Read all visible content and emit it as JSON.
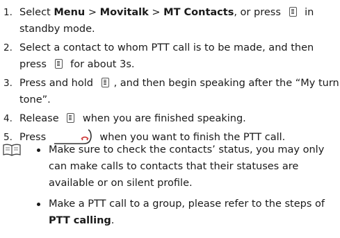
{
  "steps": [
    {
      "num": "1.",
      "a": "Select ",
      "menu": "Menu",
      "sep1": " > ",
      "movitalk": "Movitalk",
      "sep2": " > ",
      "contacts": "MT Contacts",
      "b": ", or press ",
      "c": " in standby mode."
    },
    {
      "num": "2.",
      "a": "Select a contact to whom PTT call is to be made, and then press ",
      "b": " for about 3s."
    },
    {
      "num": "3.",
      "a": "Press and hold ",
      "b": ", and then begin speaking after the “My turn tone”."
    },
    {
      "num": "4.",
      "a": "Release ",
      "b": " when you are finished speaking."
    },
    {
      "num": "5.",
      "a": "Press ",
      "b": " when you want to finish the PTT call."
    }
  ],
  "notes": [
    {
      "text": "Make sure to check the contacts’ status, you may only can make calls to contacts that their statuses are available or on silent profile."
    },
    {
      "a": "Make a PTT call to a group, please refer to the steps of ",
      "bold": "PTT calling",
      "b": "."
    }
  ],
  "icons": {
    "ptt_key": "ptt-key-icon",
    "end_key": "end-call-key-icon",
    "note": "book-note-icon"
  }
}
